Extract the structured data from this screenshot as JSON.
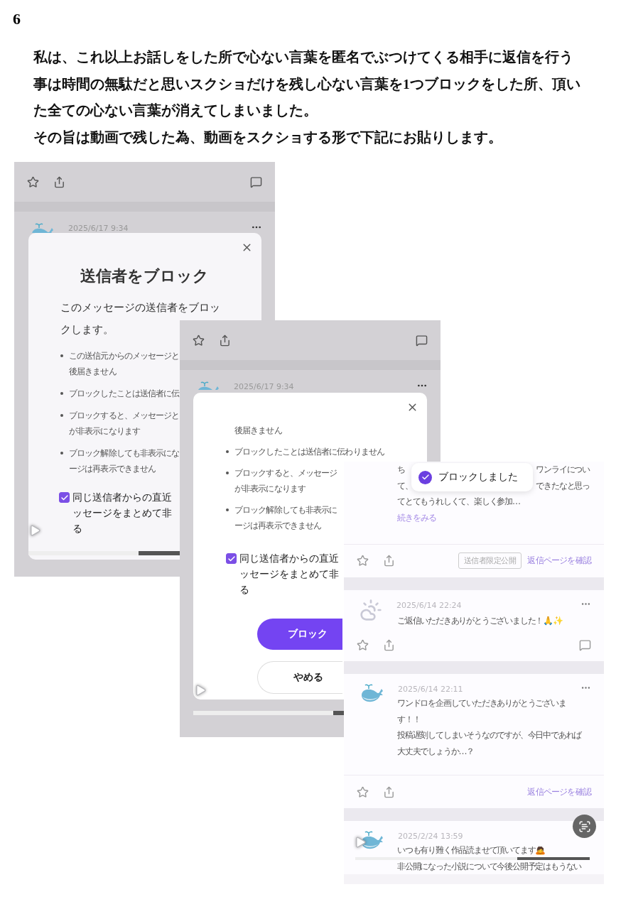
{
  "page_number": "6",
  "statement": [
    {
      "lines": [
        "私は、これ以上お話しをした所で心ない言葉を匿名でぶつけてくる相手に返信を行う",
        "事は時間の無駄だと思いスクショだけを残し心ない言葉を1つブロックをした所、頂い",
        "た全ての心ない言葉が消えてしまいました。"
      ]
    },
    {
      "lines": [
        "その旨は動画で残した為、動画をスクショする形で下記にお貼りします。"
      ]
    }
  ],
  "screenshot_1": {
    "post_time": "2025/6/17 9:34",
    "dialog": {
      "title": "送信者をブロック",
      "intro_lines": [
        "このメッセージの送信者をブロッ",
        "クします。"
      ],
      "bullets": [
        [
          "この送信元からのメッセージと",
          "後届きません"
        ],
        [
          "ブロックしたことは送信者に伝"
        ],
        [
          "ブロックすると、メッセージと",
          "が非表示になります"
        ],
        [
          "ブロック解除しても非表示にな",
          "ージは再表示できません"
        ]
      ],
      "option": {
        "lines": [
          "同じ送信者からの直近",
          "ッセージをまとめて非",
          "る"
        ],
        "checked": true
      }
    },
    "playback": {
      "level": 0.73
    }
  },
  "screenshot_2": {
    "post_time": "2025/6/17 9:34",
    "dialog": {
      "lead_line": "後届きません",
      "bullets": [
        [
          "ブロックしたことは送信者に伝わりません"
        ],
        [
          "ブロックすると、メッセージ",
          "が非表示になります"
        ],
        [
          "ブロック解除しても非表示に",
          "ージは再表示できません"
        ]
      ],
      "option": {
        "lines": [
          "同じ送信者からの直近",
          "ッセージをまとめて非",
          "る"
        ],
        "checked": true
      },
      "buttons": [
        {
          "label": "ブロック",
          "kind": "primary"
        },
        {
          "label": "やめる",
          "kind": "secondary"
        }
      ]
    },
    "playback": {
      "level": 0.93
    }
  },
  "screenshot_3": {
    "toast": "ブロックしました",
    "excerpt": {
      "rows": [
        {
          "left": "ち",
          "right": "ワンライについ"
        },
        {
          "left": "て、",
          "right": "できたなと思っ"
        }
      ],
      "lines": [
        "てとてもうれしくて、楽しく参加…"
      ],
      "more_link": "続きをみる"
    },
    "excerpt_footer": {
      "tag": "送信者限定公開",
      "link": "返信ページを確認"
    },
    "messages": [
      {
        "kind": "cloud",
        "menu": true,
        "time": "2025/6/14 22:24",
        "lines": [
          "ご返信いただきありがとうございました！🙏✨"
        ],
        "footer": {
          "kind": "comment"
        }
      },
      {
        "kind": "whale",
        "menu": true,
        "time": "2025/6/14 22:11",
        "lines": [
          "ワンドロを企画していただきありがとうございま",
          "す！！",
          "投稿遅刻してしまいそうなのですが、今日中であれば",
          "大丈夫でしょうか…？"
        ],
        "footer": {
          "kind": "link",
          "label": "返信ページを確認"
        }
      },
      {
        "kind": "whale",
        "time": "2025/2/24 13:59",
        "lines": [
          "いつも有り難く作品読ませて頂いてます🙇",
          "非公開になった小説について今後公開予定はもうない"
        ]
      }
    ],
    "playback": {
      "level": 0.69
    }
  }
}
